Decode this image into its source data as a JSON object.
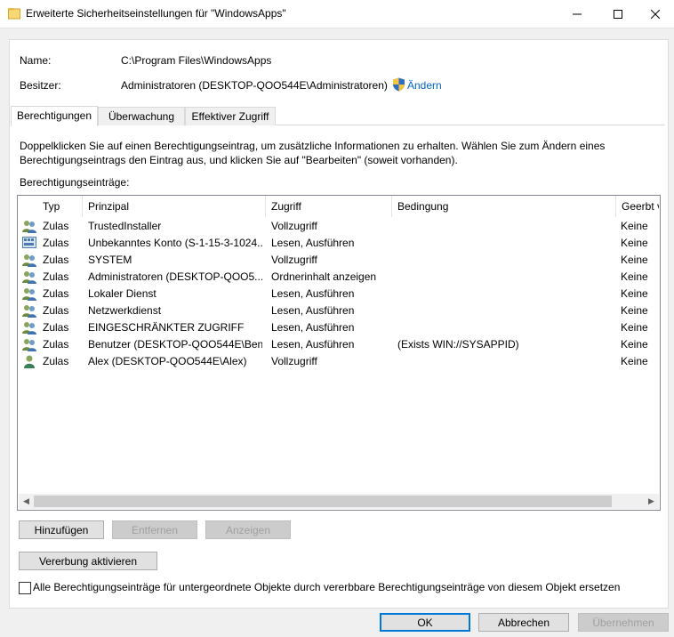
{
  "window": {
    "title": "Erweiterte Sicherheitseinstellungen für \"WindowsApps\"",
    "controls": {
      "minimize": "—",
      "maximize": "☐",
      "close": "✕"
    }
  },
  "info": {
    "name_label": "Name:",
    "name_value": "C:\\Program Files\\WindowsApps",
    "owner_label": "Besitzer:",
    "owner_value": "Administratoren (DESKTOP-QOO544E\\Administratoren)",
    "change_link": "Ändern"
  },
  "tabs": [
    {
      "label": "Berechtigungen",
      "active": true
    },
    {
      "label": "Überwachung",
      "active": false
    },
    {
      "label": "Effektiver Zugriff",
      "active": false
    }
  ],
  "description": "Doppelklicken Sie auf einen Berechtigungseintrag, um zusätzliche Informationen zu erhalten. Wählen Sie zum Ändern eines Berechtigungseintrags den Eintrag aus, und klicken Sie auf \"Bearbeiten\" (soweit vorhanden).",
  "entries_label": "Berechtigungseinträge:",
  "columns": [
    "Typ",
    "Prinzipal",
    "Zugriff",
    "Bedingung",
    "Geerbt v"
  ],
  "rows": [
    {
      "icon": "group-icon",
      "type": "Zulas",
      "principal": "TrustedInstaller",
      "access": "Vollzugriff",
      "condition": "",
      "inherited": "Keine"
    },
    {
      "icon": "unknown-account-icon",
      "type": "Zulas",
      "principal": "Unbekanntes Konto (S-1-15-3-1024...",
      "access": "Lesen, Ausführen",
      "condition": "",
      "inherited": "Keine"
    },
    {
      "icon": "group-icon",
      "type": "Zulas",
      "principal": "SYSTEM",
      "access": "Vollzugriff",
      "condition": "",
      "inherited": "Keine"
    },
    {
      "icon": "group-icon",
      "type": "Zulas",
      "principal": "Administratoren (DESKTOP-QOO5...",
      "access": "Ordnerinhalt anzeigen",
      "condition": "",
      "inherited": "Keine"
    },
    {
      "icon": "group-icon",
      "type": "Zulas",
      "principal": "Lokaler Dienst",
      "access": "Lesen, Ausführen",
      "condition": "",
      "inherited": "Keine"
    },
    {
      "icon": "group-icon",
      "type": "Zulas",
      "principal": "Netzwerkdienst",
      "access": "Lesen, Ausführen",
      "condition": "",
      "inherited": "Keine"
    },
    {
      "icon": "group-icon",
      "type": "Zulas",
      "principal": "EINGESCHRÄNKTER ZUGRIFF",
      "access": "Lesen, Ausführen",
      "condition": "",
      "inherited": "Keine"
    },
    {
      "icon": "group-icon",
      "type": "Zulas",
      "principal": "Benutzer (DESKTOP-QOO544E\\Ben...",
      "access": "Lesen, Ausführen",
      "condition": "(Exists WIN://SYSAPPID)",
      "inherited": "Keine"
    },
    {
      "icon": "user-icon",
      "type": "Zulas",
      "principal": "Alex (DESKTOP-QOO544E\\Alex)",
      "access": "Vollzugriff",
      "condition": "",
      "inherited": "Keine"
    }
  ],
  "buttons": {
    "add": "Hinzufügen",
    "remove": "Entfernen",
    "view": "Anzeigen",
    "enable_inheritance": "Vererbung aktivieren",
    "ok": "OK",
    "cancel": "Abbrechen",
    "apply": "Übernehmen"
  },
  "replace_checkbox": {
    "label": "Alle Berechtigungseinträge für untergeordnete Objekte durch vererbbare Berechtigungseinträge von diesem Objekt ersetzen",
    "checked": false
  },
  "colors": {
    "accent": "#0078d7",
    "link": "#0066cc",
    "folder": "#f5c542"
  }
}
